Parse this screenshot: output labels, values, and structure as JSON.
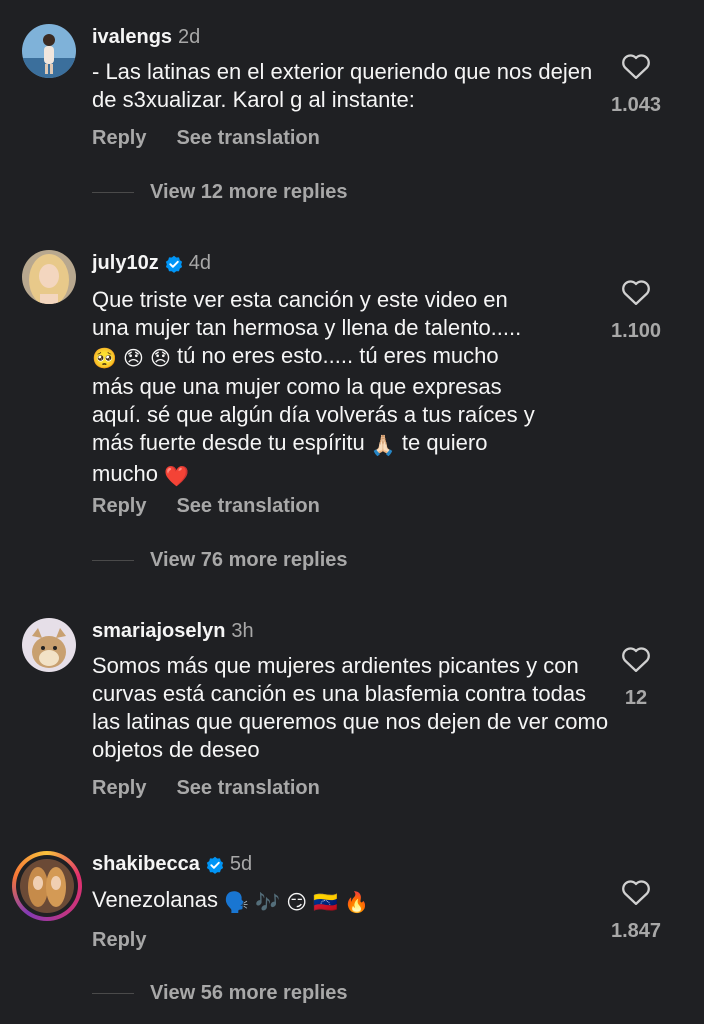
{
  "comments": [
    {
      "username": "ivalengs",
      "time": "2d",
      "verified": false,
      "text": "- Las latinas en el exterior queriendo que nos dejen de s3xualizar. Karol g al instante:",
      "likes": "1.043",
      "reply_label": "Reply",
      "translate_label": "See translation",
      "view_replies": "View 12 more replies"
    },
    {
      "username": "july10z",
      "time": "4d",
      "verified": true,
      "text_line1": "Que triste ver esta canción y este video en",
      "text_line2": "una mujer tan hermosa y llena de talento.....",
      "text_line3": "tú no eres esto..... tú eres mucho",
      "text_line4": "más que una mujer como la que expresas",
      "text_line5": "aquí. sé que algún día volverás a tus raíces y",
      "text_line6a": "más fuerte desde tu espíritu",
      "text_line6b": "te quiero",
      "text_line7": "mucho",
      "emoji_pleading": "🥺",
      "emoji_sad1": "😞",
      "emoji_sad2": "😞",
      "emoji_pray": "🙏🏻",
      "emoji_heart": "❤️",
      "likes": "1.100",
      "reply_label": "Reply",
      "translate_label": "See translation",
      "view_replies": "View 76 more replies"
    },
    {
      "username": "smariajoselyn",
      "time": "3h",
      "verified": false,
      "text": "Somos más que mujeres ardientes picantes y con curvas está canción es una blasfemia contra todas las latinas que queremos que nos dejen de ver como objetos de deseo",
      "likes": "12",
      "reply_label": "Reply",
      "translate_label": "See translation"
    },
    {
      "username": "shakibecca",
      "time": "5d",
      "verified": true,
      "text": "Venezolanas",
      "emoji_speak": "🗣️",
      "emoji_music": "🎶",
      "emoji_smirk": "😏",
      "emoji_flag": "🇻🇪",
      "emoji_fire": "🔥",
      "likes": "1.847",
      "reply_label": "Reply",
      "view_replies": "View 56 more replies"
    }
  ],
  "colors": {
    "background": "#1f2023",
    "text": "#f5f5f5",
    "muted": "#a8a8a8",
    "verified": "#0095f6"
  }
}
